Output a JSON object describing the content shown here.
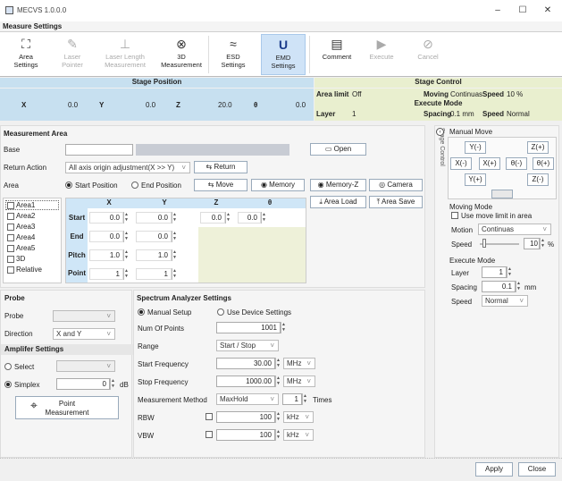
{
  "window": {
    "title": "MECVS 1.0.0.0",
    "minimize": "–",
    "maximize": "☐",
    "close": "✕"
  },
  "tab": "Measure Settings",
  "ribbon": [
    {
      "label1": "Area",
      "label2": "Settings",
      "icon": "⛶",
      "icon_name": "area-settings-icon"
    },
    {
      "label1": "Laser",
      "label2": "Pointer",
      "icon": "✎",
      "icon_name": "laser-pointer-icon"
    },
    {
      "label1": "Laser Length",
      "label2": "Measurement",
      "icon": "⊥",
      "icon_name": "laser-length-icon"
    },
    {
      "label1": "3D",
      "label2": "Measurement",
      "icon": "⊗",
      "icon_name": "3d-measurement-icon"
    },
    {
      "label1": "ESD",
      "label2": "Settings",
      "icon": "≈",
      "icon_name": "esd-settings-icon"
    },
    {
      "label1": "EMD",
      "label2": "Settings",
      "icon": "U",
      "icon_name": "emd-settings-icon"
    },
    {
      "label1": "Comment",
      "label2": "",
      "icon": "▤",
      "icon_name": "comment-icon"
    },
    {
      "label1": "Execute",
      "label2": "",
      "icon": "▶",
      "icon_name": "execute-icon"
    },
    {
      "label1": "Cancel",
      "label2": "",
      "icon": "⊘",
      "icon_name": "cancel-icon"
    }
  ],
  "stage_position": {
    "title": "Stage Position",
    "x_label": "X",
    "x": "0.0",
    "y_label": "Y",
    "y": "0.0",
    "z_label": "Z",
    "z": "20.0",
    "t_label": "θ",
    "t": "0.0"
  },
  "stage_control": {
    "title": "Stage Control",
    "area_limit_label": "Area limit",
    "area_limit": "Off",
    "moving_label": "Moving",
    "moving": "Continuas",
    "speed_label": "Speed",
    "speed": "10 %",
    "execute_mode": "Execute Mode",
    "layer_label": "Layer",
    "layer": "1",
    "spacing_label": "Spacing",
    "spacing": "0.1 mm",
    "speed2_label": "Speed",
    "speed2": "Normal"
  },
  "measurement_area": {
    "title": "Measurement Area",
    "base_label": "Base",
    "base_value": "",
    "open": "Open",
    "return_action_label": "Return Action",
    "return_action": "All axis origin adjustment(X >> Y)",
    "return_btn": "Return",
    "area_label": "Area",
    "start_position": "Start Position",
    "end_position": "End Position",
    "move_btn": "Move",
    "memory_btn": "Memory",
    "memory_z_btn": "Memory-Z",
    "camera_btn": "Camera",
    "area_load_btn": "Area Load",
    "area_save_btn": "Area Save",
    "areas": [
      "Area1",
      "Area2",
      "Area3",
      "Area4",
      "Area5",
      "3D",
      "Relative"
    ],
    "columns": [
      "X",
      "Y",
      "Z",
      "θ"
    ],
    "rows": [
      {
        "label": "Start",
        "x": "0.0",
        "y": "0.0",
        "z": "0.0",
        "t": "0.0"
      },
      {
        "label": "End",
        "x": "0.0",
        "y": "0.0"
      },
      {
        "label": "Pitch",
        "x": "1.0",
        "y": "1.0"
      },
      {
        "label": "Point",
        "x": "1",
        "y": "1"
      }
    ]
  },
  "probe": {
    "title": "Probe",
    "probe_label": "Probe",
    "probe_value": "",
    "direction_label": "Direction",
    "direction": "X and Y"
  },
  "amplifier": {
    "title": "Amplifer Settings",
    "select": "Select",
    "simplex": "Simplex",
    "simplex_value": "0",
    "unit": "dB",
    "point_btn1": "Point",
    "point_btn2": "Measurement"
  },
  "spectrum": {
    "title": "Spectrum Analyzer Settings",
    "manual": "Manual Setup",
    "device": "Use Device Settings",
    "num_points_label": "Num Of Points",
    "num_points": "1001",
    "range_label": "Range",
    "range": "Start / Stop",
    "start_freq_label": "Start Frequency",
    "start_freq": "30.00",
    "start_unit": "MHz",
    "stop_freq_label": "Stop Frequency",
    "stop_freq": "1000.00",
    "stop_unit": "MHz",
    "method_label": "Measurement Method",
    "method": "MaxHold",
    "times_value": "1",
    "times": "Times",
    "rbw_label": "RBW",
    "rbw": "100",
    "rbw_unit": "kHz",
    "vbw_label": "VBW",
    "vbw": "100",
    "vbw_unit": "kHz"
  },
  "side": {
    "vertical_label": "Stage Control",
    "manual_move": "Manual Move",
    "yminus": "Y(-)",
    "zplus": "Z(+)",
    "xminus": "X(-)",
    "xplus": "X(+)",
    "tminus": "θ(-)",
    "tplus": "θ(+)",
    "yplus": "Y(+)",
    "zminus": "Z(-)",
    "moving_mode": "Moving Mode",
    "use_limit": "Use move limit in area",
    "motion_label": "Motion",
    "motion": "Continuas",
    "speed_label": "Speed",
    "speed_value": "10",
    "speed_unit": "%",
    "execute_mode": "Execute Mode",
    "layer_label": "Layer",
    "layer": "1",
    "spacing_label": "Spacing",
    "spacing": "0.1",
    "spacing_unit": "mm",
    "speed2_label": "Speed",
    "speed2": "Normal"
  },
  "footer": {
    "apply": "Apply",
    "close": "Close"
  }
}
